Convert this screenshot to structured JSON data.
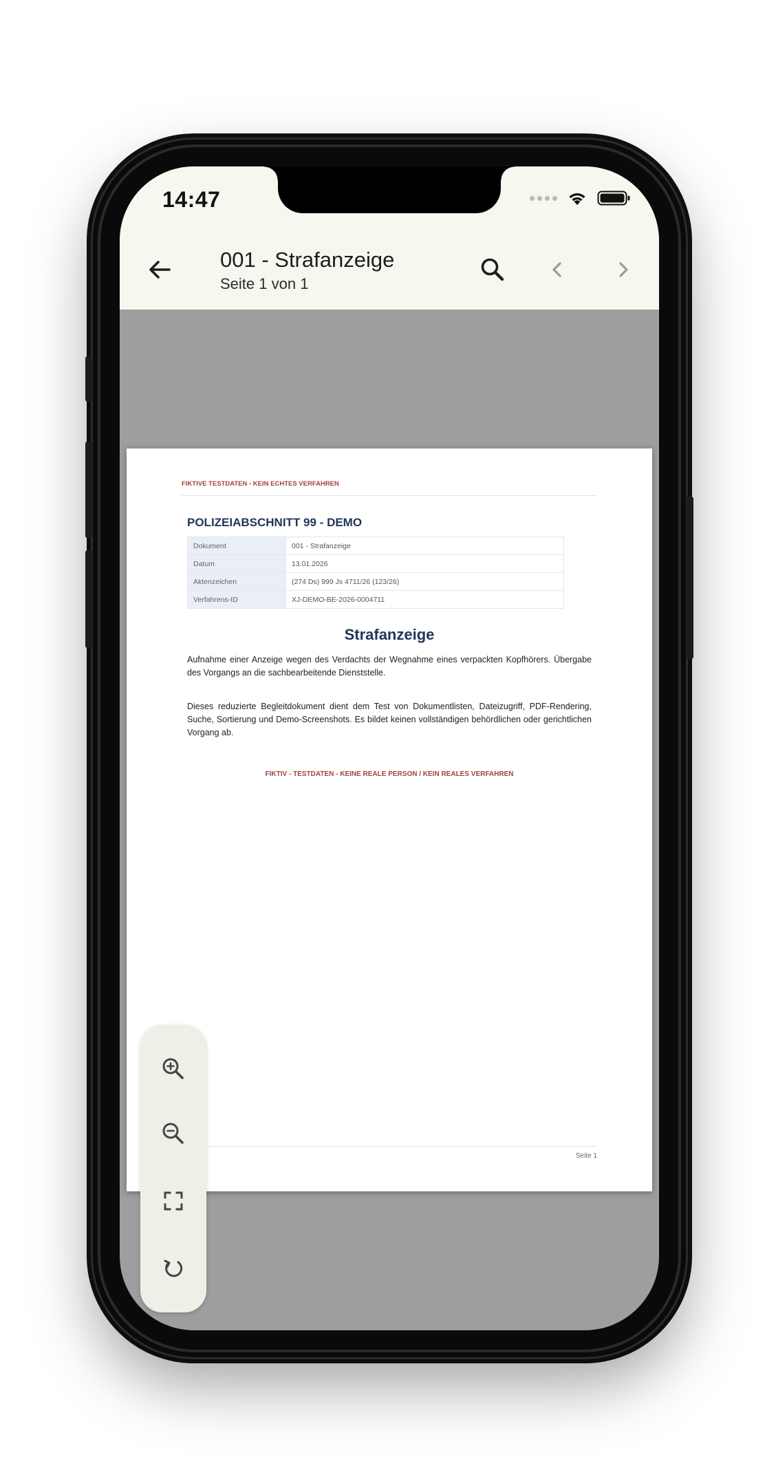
{
  "status_bar": {
    "time": "14:47"
  },
  "app_bar": {
    "title": "001 - Strafanzeige",
    "subtitle": "Seite 1 von 1",
    "icons": {
      "back": "arrow-left-icon",
      "search": "search-icon",
      "previous": "chevron-left-icon",
      "next": "chevron-right-icon"
    },
    "background": "#f7f7ef"
  },
  "viewer": {
    "background": "#9e9e9e"
  },
  "document": {
    "banner_top": "FIKTIVE TESTDATEN - KEIN ECHTES VERFAHREN",
    "heading": "POLIZEIABSCHNITT 99 - DEMO",
    "meta_rows": [
      {
        "key": "Dokument",
        "value": "001 - Strafanzeige"
      },
      {
        "key": "Datum",
        "value": "13.01.2026"
      },
      {
        "key": "Aktenzeichen",
        "value": "(274 Ds) 999 Js 4711/26 (123/26)"
      },
      {
        "key": "Verfahrens-ID",
        "value": "XJ-DEMO-BE-2026-0004711"
      }
    ],
    "title": "Strafanzeige",
    "paragraph_1": "Aufnahme einer Anzeige wegen des Verdachts der Wegnahme eines verpackten Kopfhörers. Übergabe des Vorgangs an die sachbearbeitende Dienststelle.",
    "paragraph_2": "Dieses reduzierte Begleitdokument dient dem Test von Dokumentlisten, Dateizugriff, PDF-Rendering, Suche, Sortierung und Demo-Screenshots. Es bildet keinen vollständigen behördlichen oder gerichtlichen Vorgang ab.",
    "banner_bottom": "FIKTIV - TESTDATEN - KEINE REALE PERSON / KEIN REALES VERFAHREN",
    "footer": "Seite 1",
    "colors": {
      "heading": "#22365a",
      "banner": "#a0433c"
    }
  },
  "zoom_controls": {
    "icons": [
      "zoom-in-icon",
      "zoom-out-icon",
      "fit-screen-icon",
      "rotate-icon"
    ]
  }
}
